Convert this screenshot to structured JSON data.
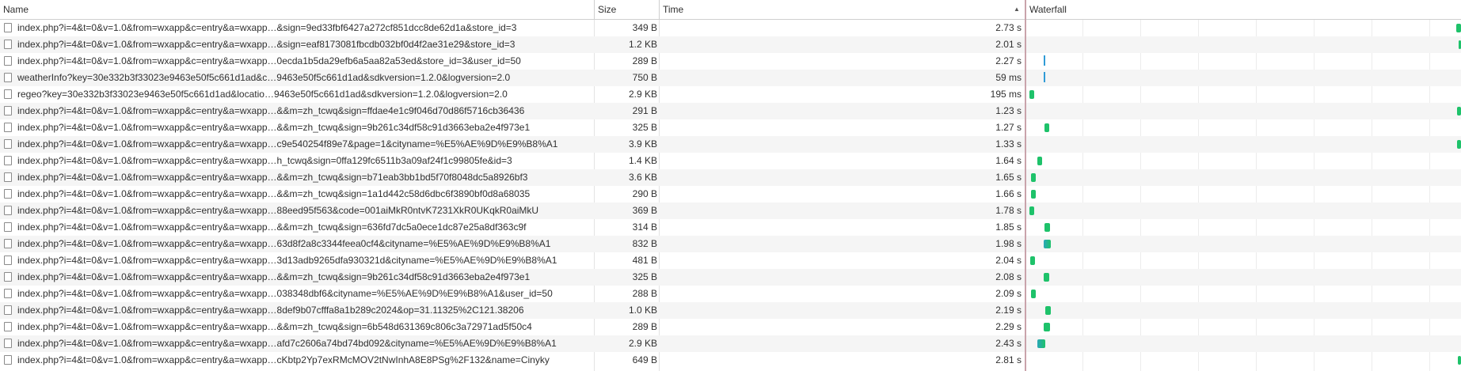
{
  "columns": {
    "name": "Name",
    "size": "Size",
    "time": "Time",
    "waterfall": "Waterfall",
    "sort_indicator": "▲"
  },
  "colors": {
    "bar_receive": "#1ec26a",
    "bar_wait": "#2f9bd6",
    "waterfall_divider": "#c9a3ab"
  },
  "requests": [
    {
      "name": "index.php?i=4&t=0&v=1.0&from=wxapp&c=entry&a=wxapp…&sign=9ed33fbf6427a272cf851dcc8de62d1a&store_id=3",
      "size": "349 B",
      "time": "2.73 s"
    },
    {
      "name": "index.php?i=4&t=0&v=1.0&from=wxapp&c=entry&a=wxapp…&sign=eaf8173081fbcdb032bf0d4f2ae31e29&store_id=3",
      "size": "1.2 KB",
      "time": "2.01 s"
    },
    {
      "name": "index.php?i=4&t=0&v=1.0&from=wxapp&c=entry&a=wxapp…0ecda1b5da29efb6a5aa82a53ed&store_id=3&user_id=50",
      "size": "289 B",
      "time": "2.27 s"
    },
    {
      "name": "weatherInfo?key=30e332b3f33023e9463e50f5c661d1ad&c…9463e50f5c661d1ad&sdkversion=1.2.0&logversion=2.0",
      "size": "750 B",
      "time": "59 ms"
    },
    {
      "name": "regeo?key=30e332b3f33023e9463e50f5c661d1ad&locatio…9463e50f5c661d1ad&sdkversion=1.2.0&logversion=2.0",
      "size": "2.9 KB",
      "time": "195 ms"
    },
    {
      "name": "index.php?i=4&t=0&v=1.0&from=wxapp&c=entry&a=wxapp…&&m=zh_tcwq&sign=ffdae4e1c9f046d70d86f5716cb36436",
      "size": "291 B",
      "time": "1.23 s"
    },
    {
      "name": "index.php?i=4&t=0&v=1.0&from=wxapp&c=entry&a=wxapp…&&m=zh_tcwq&sign=9b261c34df58c91d3663eba2e4f973e1",
      "size": "325 B",
      "time": "1.27 s"
    },
    {
      "name": "index.php?i=4&t=0&v=1.0&from=wxapp&c=entry&a=wxapp…c9e540254f89e7&page=1&cityname=%E5%AE%9D%E9%B8%A1",
      "size": "3.9 KB",
      "time": "1.33 s"
    },
    {
      "name": "index.php?i=4&t=0&v=1.0&from=wxapp&c=entry&a=wxapp…h_tcwq&sign=0ffa129fc6511b3a09af24f1c99805fe&id=3",
      "size": "1.4 KB",
      "time": "1.64 s"
    },
    {
      "name": "index.php?i=4&t=0&v=1.0&from=wxapp&c=entry&a=wxapp…&&m=zh_tcwq&sign=b71eab3bb1bd5f70f8048dc5a8926bf3",
      "size": "3.6 KB",
      "time": "1.65 s"
    },
    {
      "name": "index.php?i=4&t=0&v=1.0&from=wxapp&c=entry&a=wxapp…&&m=zh_tcwq&sign=1a1d442c58d6dbc6f3890bf0d8a68035",
      "size": "290 B",
      "time": "1.66 s"
    },
    {
      "name": "index.php?i=4&t=0&v=1.0&from=wxapp&c=entry&a=wxapp…88eed95f563&code=001aiMkR0ntvK7231XkR0UKqkR0aiMkU",
      "size": "369 B",
      "time": "1.78 s"
    },
    {
      "name": "index.php?i=4&t=0&v=1.0&from=wxapp&c=entry&a=wxapp…&&m=zh_tcwq&sign=636fd7dc5a0ece1dc87e25a8df363c9f",
      "size": "314 B",
      "time": "1.85 s"
    },
    {
      "name": "index.php?i=4&t=0&v=1.0&from=wxapp&c=entry&a=wxapp…63d8f2a8c3344feea0cf4&cityname=%E5%AE%9D%E9%B8%A1",
      "size": "832 B",
      "time": "1.98 s"
    },
    {
      "name": "index.php?i=4&t=0&v=1.0&from=wxapp&c=entry&a=wxapp…3d13adb9265dfa930321d&cityname=%E5%AE%9D%E9%B8%A1",
      "size": "481 B",
      "time": "2.04 s"
    },
    {
      "name": "index.php?i=4&t=0&v=1.0&from=wxapp&c=entry&a=wxapp…&&m=zh_tcwq&sign=9b261c34df58c91d3663eba2e4f973e1",
      "size": "325 B",
      "time": "2.08 s"
    },
    {
      "name": "index.php?i=4&t=0&v=1.0&from=wxapp&c=entry&a=wxapp…038348dbf6&cityname=%E5%AE%9D%E9%B8%A1&user_id=50",
      "size": "288 B",
      "time": "2.09 s"
    },
    {
      "name": "index.php?i=4&t=0&v=1.0&from=wxapp&c=entry&a=wxapp…8def9b07cfffa8a1b289c2024&op=31.11325%2C121.38206",
      "size": "1.0 KB",
      "time": "2.19 s"
    },
    {
      "name": "index.php?i=4&t=0&v=1.0&from=wxapp&c=entry&a=wxapp…&&m=zh_tcwq&sign=6b548d631369c806c3a72971ad5f50c4",
      "size": "289 B",
      "time": "2.29 s"
    },
    {
      "name": "index.php?i=4&t=0&v=1.0&from=wxapp&c=entry&a=wxapp…afd7c2606a74bd74bd092&cityname=%E5%AE%9D%E9%B8%A1",
      "size": "2.9 KB",
      "time": "2.43 s"
    },
    {
      "name": "index.php?i=4&t=0&v=1.0&from=wxapp&c=entry&a=wxapp…cKbtp2Yp7exRMcMOV2tNwInhA8E8PSg%2F132&name=Cinyky",
      "size": "649 B",
      "time": "2.81 s"
    }
  ]
}
